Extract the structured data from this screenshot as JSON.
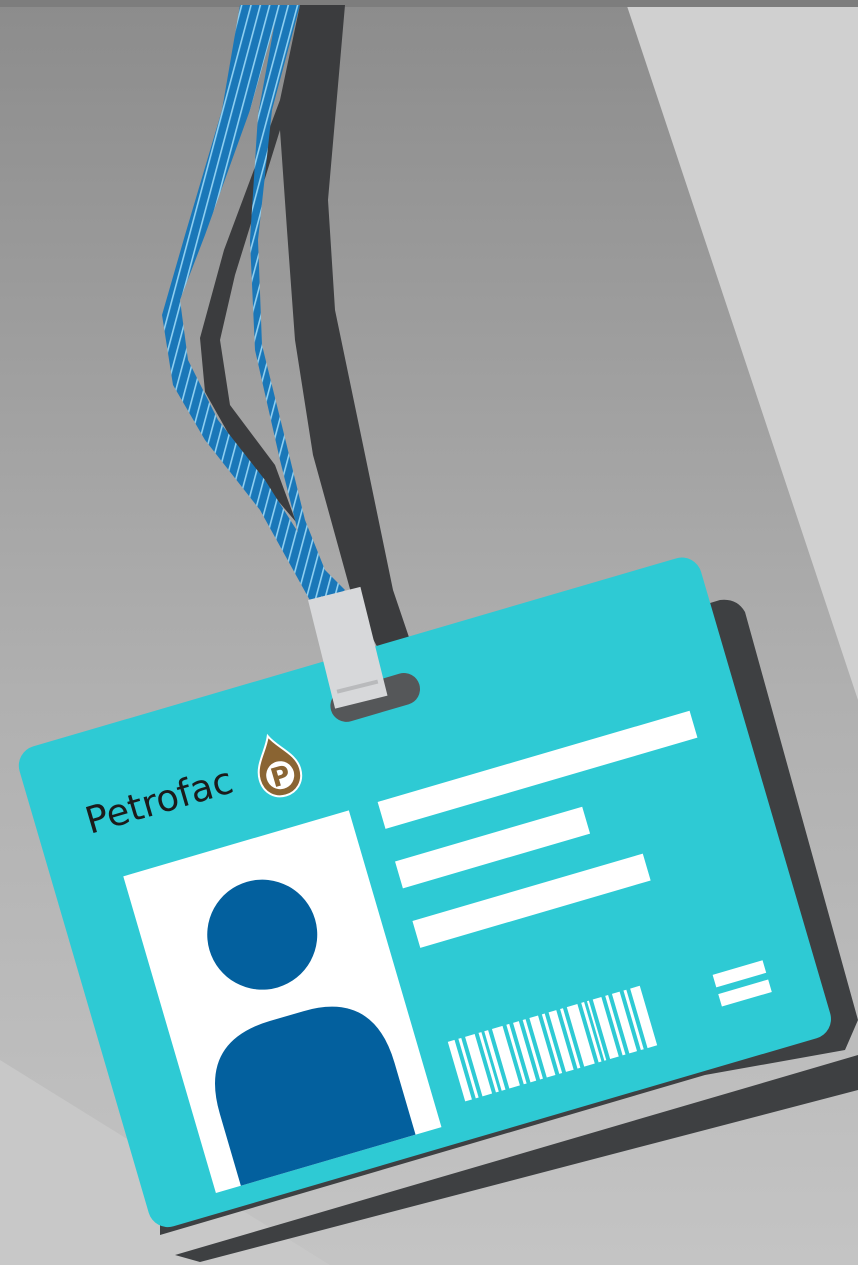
{
  "badge": {
    "company_name": "Petrofac",
    "logo_letter": "P",
    "logo_icon": "oil-drop-p-icon",
    "person_icon": "person-silhouette-icon",
    "barcode_icon": "barcode-icon"
  },
  "colors": {
    "background_dark": "#8e8e8e",
    "background_light": "#cfcfcf",
    "card_face": "#2ecad4",
    "card_back": "#3e4042",
    "lanyard_blue": "#1a77b8",
    "lanyard_stripe": "#8fd0f2",
    "lanyard_dark": "#3b3c3e",
    "photo_bg": "#ffffff",
    "person": "#03609e",
    "logo_brown": "#8a6432",
    "clip": "#d7d8da"
  }
}
